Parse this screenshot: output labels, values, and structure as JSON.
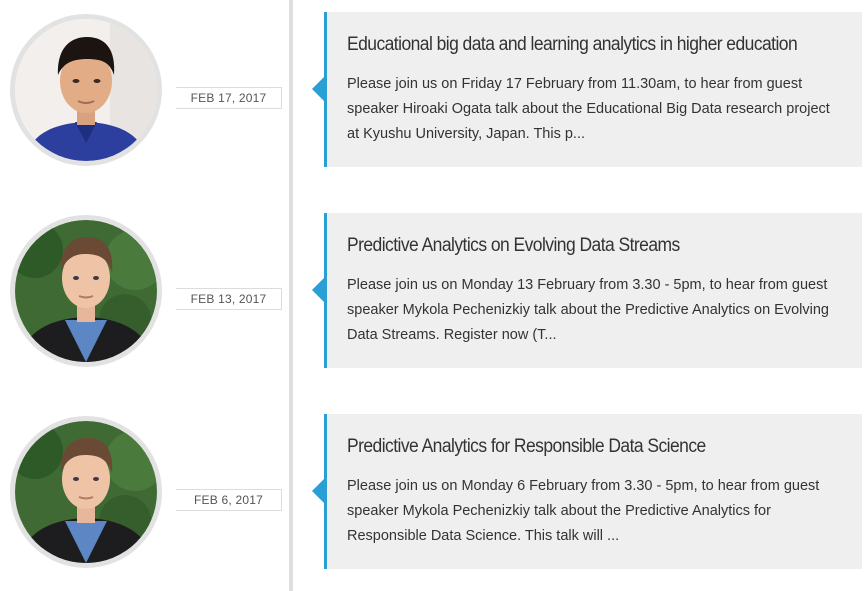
{
  "events": [
    {
      "date": "FEB 17, 2017",
      "title": "Educational big data and learning analytics in higher education",
      "excerpt": "Please join us on Friday 17 February from 11.30am, to hear from guest speaker Hiroaki Ogata talk about the Educational Big Data research project at Kyushu University, Japan. This p...",
      "avatar": "speaker-photo-asian-man"
    },
    {
      "date": "FEB 13, 2017",
      "title": "Predictive Analytics on Evolving Data Streams",
      "excerpt": "Please join us on Monday 13 February from 3.30 - 5pm, to hear from guest speaker Mykola Pechenizkiy talk about the Predictive Analytics on Evolving Data Streams. Register now (T...",
      "avatar": "speaker-photo-young-man"
    },
    {
      "date": "FEB 6, 2017",
      "title": "Predictive Analytics for Responsible Data Science",
      "excerpt": "Please join us on Monday 6 February from 3.30 - 5pm, to hear from guest speaker Mykola Pechenizkiy talk about the Predictive Analytics for Responsible Data Science. This talk will ...",
      "avatar": "speaker-photo-young-man"
    }
  ],
  "colors": {
    "accent": "#2a9fd6",
    "card_background": "#efefef",
    "timeline_line": "#dedede",
    "avatar_border": "#e2e2e2"
  }
}
